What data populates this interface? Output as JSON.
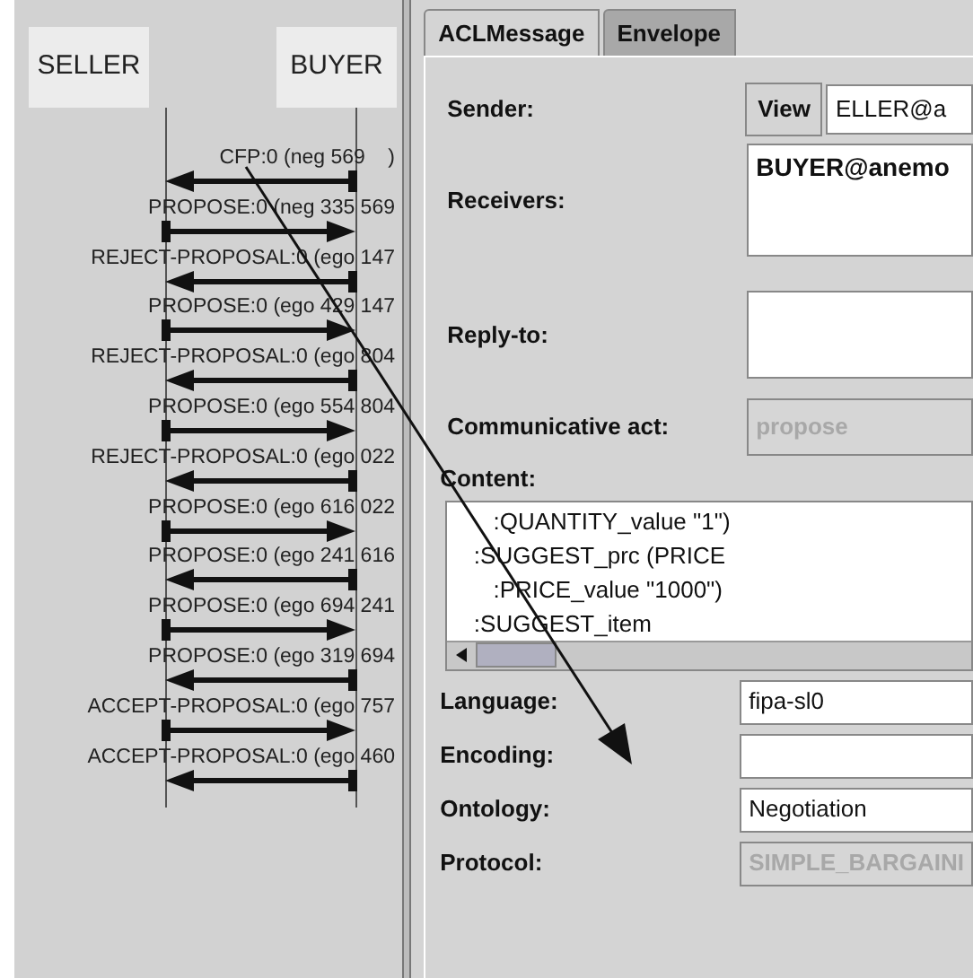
{
  "participants": [
    "SELLER",
    "BUYER"
  ],
  "messages": [
    {
      "label": "CFP:0 (neg 569    )",
      "kind": "leftward"
    },
    {
      "label": "PROPOSE:0 (neg 335 569",
      "kind": "rightward"
    },
    {
      "label": "REJECT-PROPOSAL:0 (ego 147",
      "kind": "leftward"
    },
    {
      "label": "PROPOSE:0 (ego 429 147",
      "kind": "rightward"
    },
    {
      "label": "REJECT-PROPOSAL:0 (ego 804",
      "kind": "leftward"
    },
    {
      "label": "PROPOSE:0 (ego 554 804",
      "kind": "rightward"
    },
    {
      "label": "REJECT-PROPOSAL:0 (ego 022",
      "kind": "leftward"
    },
    {
      "label": "PROPOSE:0 (ego 616 022",
      "kind": "rightward"
    },
    {
      "label": "PROPOSE:0 (ego 241 616",
      "kind": "leftward"
    },
    {
      "label": "PROPOSE:0 (ego 694 241",
      "kind": "rightward"
    },
    {
      "label": "PROPOSE:0 (ego 319 694",
      "kind": "leftward"
    },
    {
      "label": "ACCEPT-PROPOSAL:0 (ego 757",
      "kind": "rightward"
    },
    {
      "label": "ACCEPT-PROPOSAL:0 (ego 460",
      "kind": "leftward"
    }
  ],
  "tabs": [
    {
      "label": "ACLMessage",
      "selected": true
    },
    {
      "label": "Envelope",
      "selected": false
    }
  ],
  "sender": {
    "label": "Sender:",
    "button": "View",
    "value": "ELLER@a"
  },
  "receivers": {
    "label": "Receivers:",
    "value": "BUYER@anemo"
  },
  "reply_to": {
    "label": "Reply-to:"
  },
  "communicative_act": {
    "label": "Communicative act:",
    "value": "propose",
    "disabled": true
  },
  "content": {
    "label": "Content:",
    "lines": [
      "      :QUANTITY_value \"1\")",
      "   :SUGGEST_prc (PRICE",
      "      :PRICE_value \"1000\")",
      "   :SUGGEST_item"
    ]
  },
  "fields": [
    {
      "label": "Language:",
      "value": "fipa-sl0",
      "disabled": false
    },
    {
      "label": "Encoding:",
      "disabled": false
    },
    {
      "label": "Ontology:",
      "value": "Negotiation",
      "disabled": false
    },
    {
      "label": "Protocol:",
      "value": "SIMPLE_BARGAINI",
      "disabled": true
    }
  ]
}
